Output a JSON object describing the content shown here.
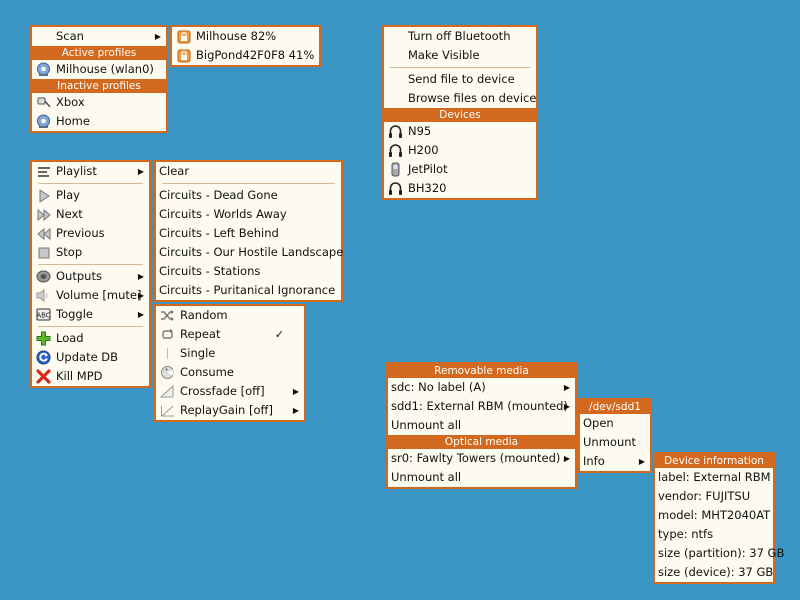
{
  "network_menu": {
    "scan_label": "Scan",
    "active_header": "Active profiles",
    "active_items": [
      "Milhouse (wlan0)"
    ],
    "inactive_header": "Inactive profiles",
    "inactive_items": [
      "Xbox",
      "Home"
    ]
  },
  "scan_submenu": {
    "items": [
      "Milhouse 82%",
      "BigPond42F0F8 41%"
    ]
  },
  "bluetooth_menu": {
    "items": [
      "Turn off Bluetooth",
      "Make Visible",
      "Send file to device",
      "Browse files on device"
    ],
    "devices_header": "Devices",
    "devices": [
      {
        "label": "N95",
        "icon": "headset-icon"
      },
      {
        "label": "H200",
        "icon": "headset-icon"
      },
      {
        "label": "JetPilot",
        "icon": "phone-icon"
      },
      {
        "label": "BH320",
        "icon": "headset-icon"
      }
    ]
  },
  "mpd_menu": {
    "playlist": "Playlist",
    "play": "Play",
    "next": "Next",
    "previous": "Previous",
    "stop": "Stop",
    "outputs": "Outputs",
    "volume": "Volume [mute]",
    "toggle": "Toggle",
    "load": "Load",
    "update_db": "Update DB",
    "kill_mpd": "Kill MPD"
  },
  "playlist_submenu": {
    "items": [
      "Clear",
      "Circuits - Dead Gone",
      "Circuits - Worlds Away",
      "Circuits - Left Behind",
      "Circuits - Our Hostile Landscape",
      "Circuits - Stations",
      "Circuits - Puritanical Ignorance"
    ]
  },
  "toggle_submenu": {
    "random": "Random",
    "repeat": "Repeat",
    "repeat_check": "✓",
    "single": "Single",
    "consume": "Consume",
    "crossfade": "Crossfade [off]",
    "replaygain": "ReplayGain [off]"
  },
  "media_menu": {
    "removable_header": "Removable media",
    "removable_items": [
      "sdc: No label (A)",
      "sdd1: External RBM (mounted)",
      "Unmount all"
    ],
    "optical_header": "Optical media",
    "optical_items": [
      "sr0: Fawlty Towers (mounted)",
      "Unmount all"
    ]
  },
  "device_submenu": {
    "header": "/dev/sdd1",
    "items": [
      "Open",
      "Unmount",
      "Info"
    ]
  },
  "device_info": {
    "header": "Device information",
    "lines": [
      "label: External RBM",
      "vendor:  FUJITSU",
      "model:  MHT2040AT",
      "type: ntfs",
      "size (partition): 37 GB",
      "size (device): 37 GB"
    ]
  },
  "colors": {
    "desktop": "#3a94c4",
    "menu_bg": "#fdfbf0",
    "accent": "#d2691e"
  }
}
